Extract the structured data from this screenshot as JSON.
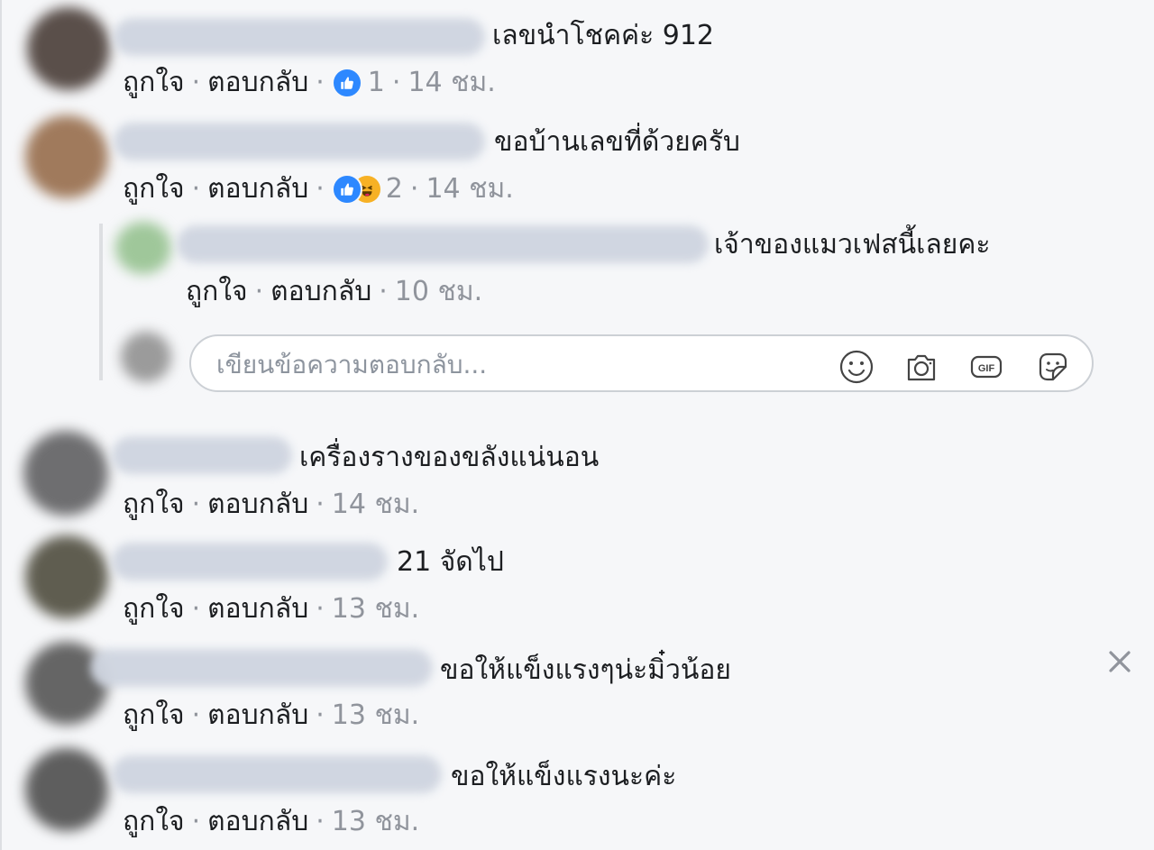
{
  "meta_labels": {
    "like": "ถูกใจ",
    "reply": "ตอบกลับ",
    "sep": "·"
  },
  "comments": [
    {
      "text": "เลขนำโชคค่ะ 912",
      "reactions": [
        "like"
      ],
      "reaction_count": "1",
      "time": "14 ชม."
    },
    {
      "text": "ขอบ้านเลขที่ด้วยครับ",
      "reactions": [
        "like",
        "haha"
      ],
      "reaction_count": "2",
      "time": "14 ชม."
    },
    {
      "text": "เครื่องรางของขลังแน่นอน",
      "time": "14 ชม."
    },
    {
      "text": "21 จัดไป",
      "time": "13 ชม."
    },
    {
      "text": "ขอให้แข็งแรงๆน่ะมิ๋วน้อย",
      "time": "13 ชม."
    },
    {
      "text": "ขอให้แข็งแรงนะค่ะ",
      "time": "13 ชม."
    }
  ],
  "reply": {
    "text": "เจ้าของแมวเฟสนี้เลยคะ",
    "time": "10 ชม."
  },
  "reply_composer": {
    "placeholder": "เขียนข้อความตอบกลับ..."
  },
  "icons": {
    "emoji": "smiley-icon",
    "camera": "camera-icon",
    "gif": "gif-icon",
    "sticker": "sticker-icon",
    "close": "close-icon"
  },
  "colors": {
    "like_blue": "#2d88ff",
    "haha_yellow": "#f7b125",
    "muted_text": "#90949c",
    "border": "#ccd0d5"
  }
}
